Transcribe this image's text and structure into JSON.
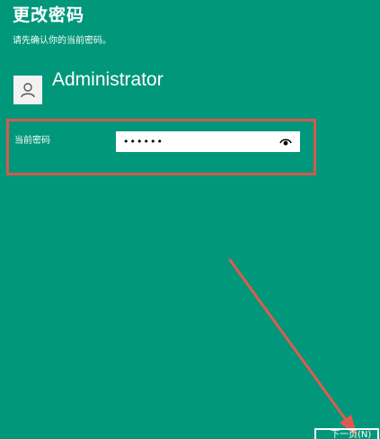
{
  "header": {
    "title": "更改密码",
    "subtitle": "请先确认你的当前密码。"
  },
  "account": {
    "username": "Administrator",
    "avatar_icon": "user-icon"
  },
  "form": {
    "current_password_label": "当前密码",
    "current_password_value": "••••••",
    "reveal_icon": "eye-icon"
  },
  "footer": {
    "next_label": "下一页(N)"
  },
  "colors": {
    "background": "#00977A",
    "highlight": "#D35A4E",
    "arrow": "#E05A50"
  }
}
